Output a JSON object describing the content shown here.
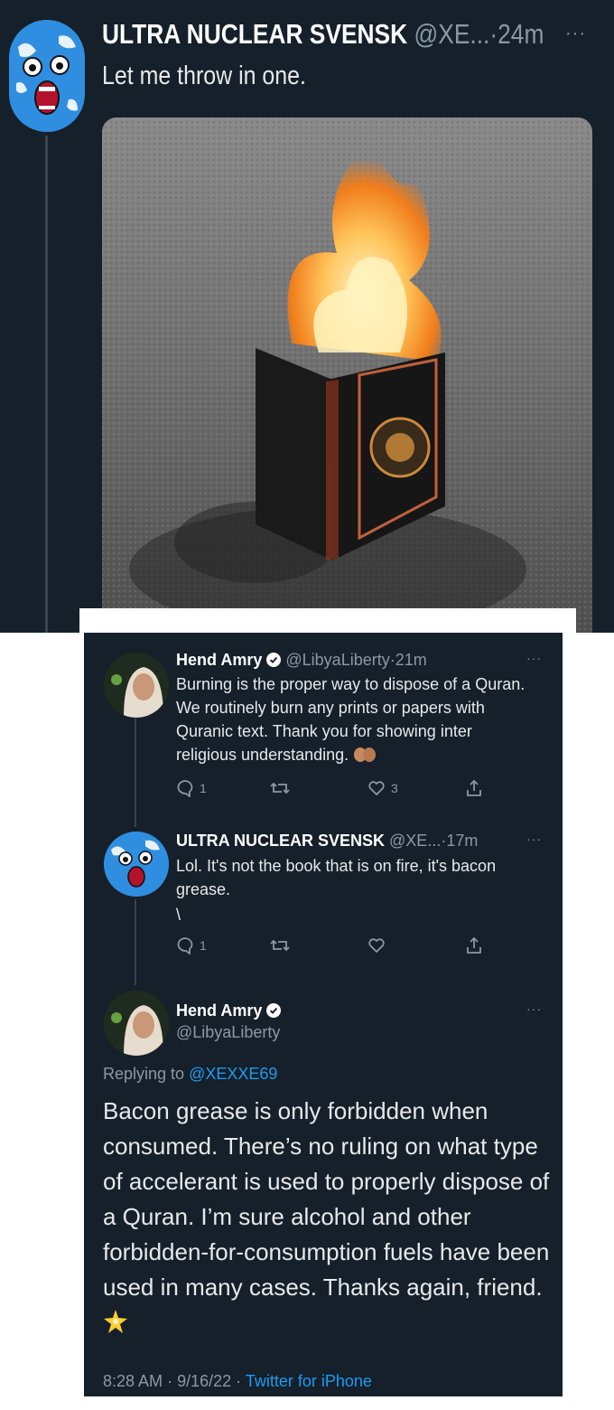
{
  "top_tweet": {
    "display_name": "ULTRA NUCLEAR SVENSK",
    "handle": "@XE...",
    "separator": "·",
    "time": "24m",
    "more": "···",
    "text": "Let me throw in one."
  },
  "replies": [
    {
      "display_name": "Hend Amry",
      "handle": "@LibyaLiberty",
      "separator": "·",
      "time": "21m",
      "more": "···",
      "text": "Burning is the proper way to dispose of a Quran. We routinely burn any prints or papers with Quranic text. Thank you for showing inter religious understanding.",
      "emoji": "hands",
      "reply_count": "1",
      "retweet_count": "",
      "like_count": "3"
    },
    {
      "display_name": "ULTRA NUCLEAR SVENSK",
      "handle": "@XE...",
      "separator": "·",
      "time": "17m",
      "more": "···",
      "text": "Lol. It's not the book that is on fire, it's bacon grease.",
      "extra_line": "\\",
      "reply_count": "1",
      "retweet_count": "",
      "like_count": ""
    }
  ],
  "main_tweet": {
    "display_name": "Hend Amry",
    "handle": "@LibyaLiberty",
    "more": "···",
    "replying_to_label": "Replying to",
    "replying_to_handle": "@XEXXE69",
    "text": "Bacon grease is only forbidden when consumed. There’s no ruling on what type of accelerant is used to properly dispose of a Quran. I’m sure alcohol and other forbidden-for-consumption fuels have been used in many cases. Thanks again, friend.",
    "emoji": "sparkle",
    "time": "8:28 AM",
    "separator": "·",
    "date": "9/16/22",
    "source": "Twitter for iPhone"
  },
  "colors": {
    "background": "#15202b",
    "text": "#e7e9ea",
    "muted": "#8b98a5",
    "link": "#1d9bf0",
    "thread_line": "#38444d"
  }
}
